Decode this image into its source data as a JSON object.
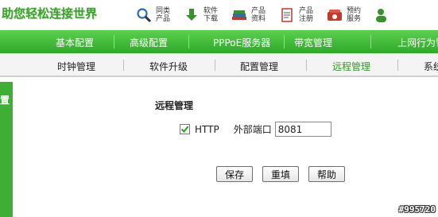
{
  "header": {
    "logo_text": "助您轻松连接世界",
    "links": [
      {
        "label": "同类产品",
        "icon": "search-icon"
      },
      {
        "label": "软件下载",
        "icon": "download-icon"
      },
      {
        "label": "产品资料",
        "icon": "books-icon"
      },
      {
        "label": "产品注册",
        "icon": "register-icon"
      },
      {
        "label": "预约服务",
        "icon": "phone-icon"
      }
    ]
  },
  "main_nav": {
    "items": [
      "基本配置",
      "高级配置",
      "PPPoE服务器",
      "带宽管理",
      "上网行为管"
    ]
  },
  "sub_nav": {
    "items": [
      "时钟管理",
      "软件升级",
      "配置管理",
      "远程管理",
      "系统"
    ],
    "active": "远程管理"
  },
  "sidebar": {
    "label": "置"
  },
  "form": {
    "title": "远程管理",
    "http_label": "HTTP",
    "http_checked": true,
    "port_label": "外部端口",
    "port_value": "8081"
  },
  "buttons": {
    "save": "保存",
    "reset": "重填",
    "help": "帮助"
  },
  "watermark": "#995720",
  "colors": {
    "nav_green": "#3fae35",
    "active_green": "#2f9a24"
  }
}
